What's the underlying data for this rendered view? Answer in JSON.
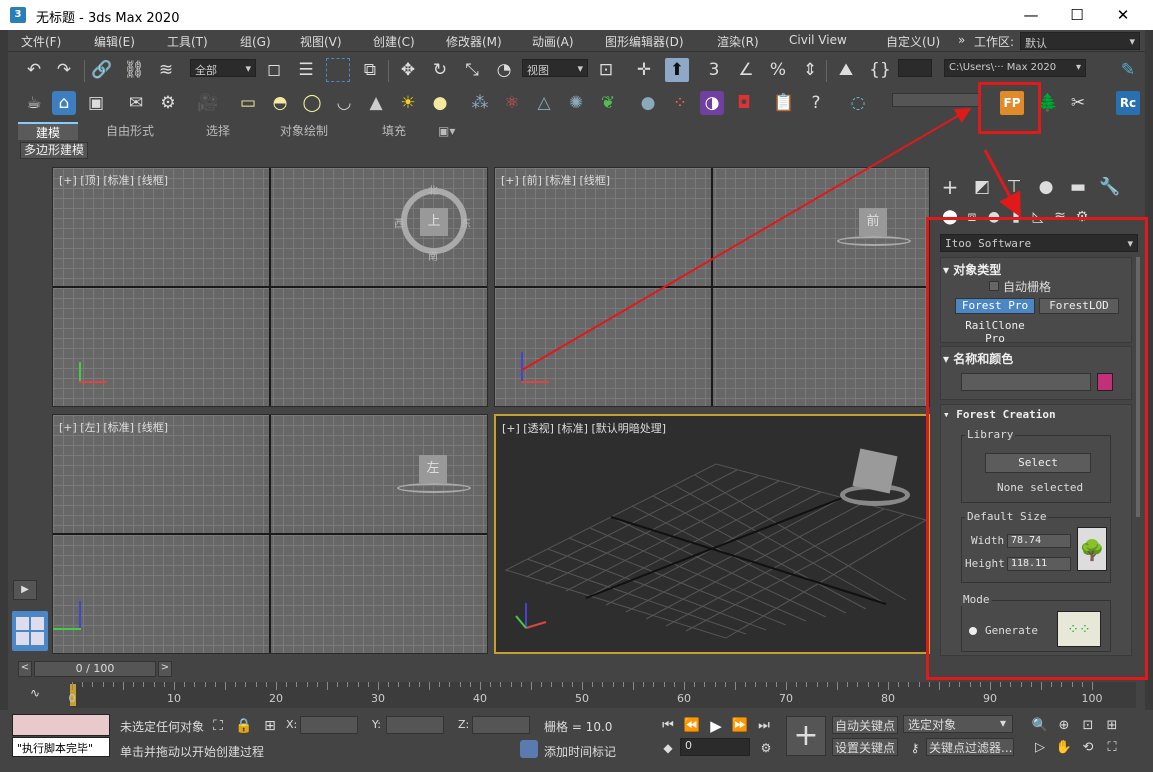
{
  "window": {
    "title": "无标题 - 3ds Max 2020",
    "app_icon": "3"
  },
  "menu": {
    "items": [
      "文件(F)",
      "编辑(E)",
      "工具(T)",
      "组(G)",
      "视图(V)",
      "创建(C)",
      "修改器(M)",
      "动画(A)",
      "图形编辑器(D)",
      "渲染(R)",
      "Civil View",
      "自定义(U)"
    ],
    "more": "»",
    "workspace_label": "工作区:",
    "workspace_value": "默认"
  },
  "toolbar1": {
    "selection_filter": "全部",
    "ref_coord": "视图",
    "project_path": "C:\\Users\\··· Max 2020"
  },
  "ribbon": {
    "tabs": [
      "建模",
      "自由形式",
      "选择",
      "对象绘制",
      "填充"
    ],
    "subtab": "多边形建模"
  },
  "viewports": [
    {
      "label": "[+] [顶] [标准] [线框]",
      "cube_face": "上",
      "compass": {
        "n": "北",
        "s": "南",
        "e": "东",
        "w": "西"
      }
    },
    {
      "label": "[+] [前] [标准] [线框]",
      "cube_face": "前"
    },
    {
      "label": "[+] [左] [标准] [线框]",
      "cube_face": "左"
    },
    {
      "label": "[+] [透视] [标准] [默认明暗处理]"
    }
  ],
  "command_panel": {
    "category": "Itoo Software",
    "object_type": {
      "title": "对象类型",
      "autogrid": "自动栅格",
      "buttons": [
        "Forest Pro",
        "ForestLOD",
        "RailClone Pro"
      ]
    },
    "name_color": {
      "title": "名称和颜色",
      "color": "#c2307a"
    },
    "forest": {
      "title": "Forest Creation",
      "library_label": "Library",
      "select_btn": "Select",
      "none_selected": "None selected",
      "default_size_label": "Default Size",
      "width_label": "Width",
      "width_value": "78.74",
      "height_label": "Height",
      "height_value": "118.11",
      "mode_label": "Mode",
      "generate_label": "Generate"
    }
  },
  "timeline": {
    "frame": "0 / 100",
    "ticks": [
      "0",
      "10",
      "20",
      "30",
      "40",
      "50",
      "60",
      "70",
      "80",
      "90",
      "100"
    ]
  },
  "status": {
    "script_result": "\"执行脚本完毕\"",
    "selection": "未选定任何对象",
    "prompt": "单击并拖动以开始创建过程",
    "x_label": "X:",
    "y_label": "Y:",
    "z_label": "Z:",
    "grid": "栅格 = 10.0",
    "add_time_tag": "添加时间标记",
    "auto_key": "自动关键点",
    "set_key": "设置关键点",
    "selected_set": "选定对象",
    "key_filters": "关键点过滤器...",
    "current_frame": "0"
  },
  "colors": {
    "annotation_red": "#e0191b",
    "accent_blue": "#4b87c6",
    "panel_bg": "#444444"
  }
}
